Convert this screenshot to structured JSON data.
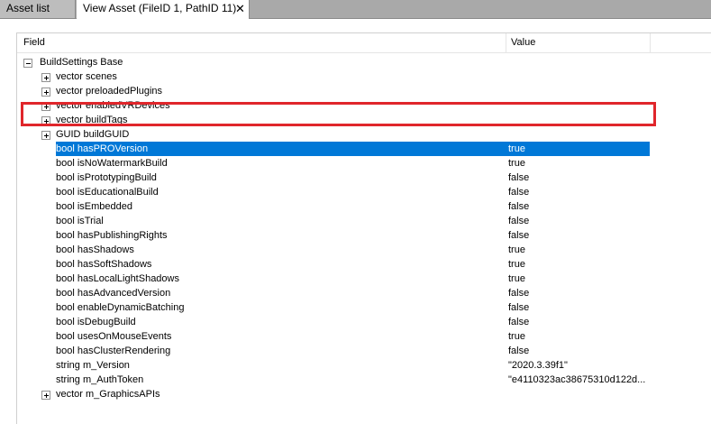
{
  "tabs": [
    {
      "label": "Asset list",
      "active": false
    },
    {
      "label": "View Asset (FileID 1, PathID 11)",
      "active": true
    }
  ],
  "close_glyph": "✕",
  "columns": {
    "field": "Field",
    "value": "Value"
  },
  "root": {
    "label": "BuildSettings Base",
    "expanded": true
  },
  "rows": [
    {
      "label": "vector scenes",
      "value": "",
      "expandable": true
    },
    {
      "label": "vector preloadedPlugins",
      "value": "",
      "expandable": true
    },
    {
      "label": "vector enabledVRDevices",
      "value": "",
      "expandable": true
    },
    {
      "label": "vector buildTags",
      "value": "",
      "expandable": true
    },
    {
      "label": "GUID buildGUID",
      "value": "",
      "expandable": true
    },
    {
      "label": "bool hasPROVersion",
      "value": "true",
      "selected": true
    },
    {
      "label": "bool isNoWatermarkBuild",
      "value": "true"
    },
    {
      "label": "bool isPrototypingBuild",
      "value": "false"
    },
    {
      "label": "bool isEducationalBuild",
      "value": "false"
    },
    {
      "label": "bool isEmbedded",
      "value": "false"
    },
    {
      "label": "bool isTrial",
      "value": "false"
    },
    {
      "label": "bool hasPublishingRights",
      "value": "false"
    },
    {
      "label": "bool hasShadows",
      "value": "true"
    },
    {
      "label": "bool hasSoftShadows",
      "value": "true"
    },
    {
      "label": "bool hasLocalLightShadows",
      "value": "true"
    },
    {
      "label": "bool hasAdvancedVersion",
      "value": "false"
    },
    {
      "label": "bool enableDynamicBatching",
      "value": "false"
    },
    {
      "label": "bool isDebugBuild",
      "value": "false"
    },
    {
      "label": "bool usesOnMouseEvents",
      "value": "true"
    },
    {
      "label": "bool hasClusterRendering",
      "value": "false"
    },
    {
      "label": "string m_Version",
      "value": "\"2020.3.39f1\""
    },
    {
      "label": "string m_AuthToken",
      "value": "\"e4110323ac38675310d122d..."
    },
    {
      "label": "vector m_GraphicsAPIs",
      "value": "",
      "expandable": true
    }
  ],
  "colors": {
    "selection": "#0078d7",
    "highlight_box": "#e0262b",
    "tab_strip": "#a9a9a9"
  }
}
